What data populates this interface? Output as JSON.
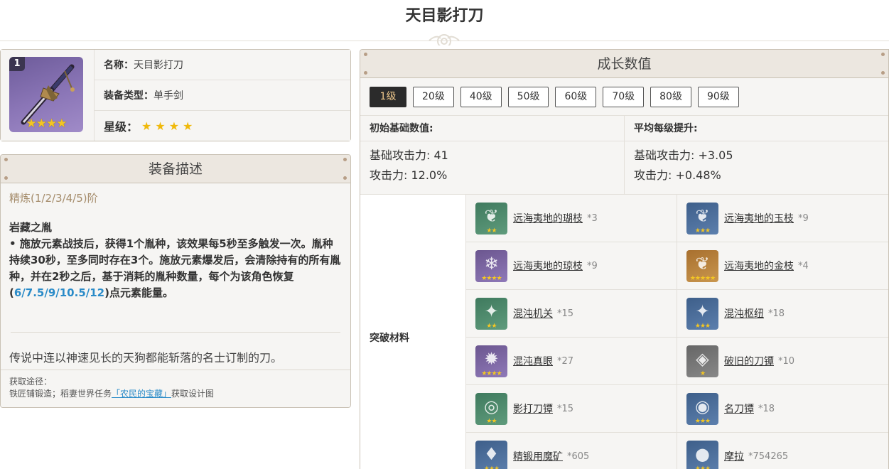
{
  "page_title": "天目影打刀",
  "info": {
    "level_badge": "1",
    "name_label": "名称：",
    "name_value": "天目影打刀",
    "type_label": "装备类型：",
    "type_value": "单手剑",
    "rarity_label": "星级：",
    "rarity_stars": 4,
    "icon_stars": "★★★★"
  },
  "description": {
    "header": "装备描述",
    "refine_label": "精炼(1/2/3/4/5)阶",
    "skill_name": "岩藏之胤",
    "skill_text_1": "• 施放元素战技后，获得1个胤种，该效果每5秒至多触发一次。胤种持续30秒，至多同时存在3个。施放元素爆发后，会清除持有的所有胤种，并在2秒之后，基于消耗的胤种数量，每个为该角色恢复(",
    "skill_values": "6/7.5/9/10.5/12",
    "skill_text_2": ")点元素能量。",
    "lore": "传说中连以神速见长的天狗都能斩落的名士订制的刀。",
    "source_title": "获取途径：",
    "source_prefix": "铁匠铺锻造；稻妻世界任务",
    "source_link": "「农民的宝藏」",
    "source_suffix": "获取设计图"
  },
  "growth": {
    "header": "成长数值",
    "tabs": [
      "1级",
      "20级",
      "40级",
      "50级",
      "60级",
      "70级",
      "80级",
      "90级"
    ],
    "active_tab": 0,
    "base_header": "初始基础数值:",
    "base_lines": [
      "基础攻击力: 41",
      "攻击力: 12.0%"
    ],
    "increase_header": "平均每级提升:",
    "increase_lines": [
      "基础攻击力: +3.05",
      "攻击力: +0.48%"
    ],
    "materials_label": "突破材料",
    "materials": [
      {
        "name": "远海夷地的瑚枝",
        "count": "*3",
        "rarity": 2,
        "icon": "coral-branch-icon",
        "glyph": "❦"
      },
      {
        "name": "远海夷地的玉枝",
        "count": "*9",
        "rarity": 3,
        "icon": "jade-branch-icon",
        "glyph": "❦"
      },
      {
        "name": "远海夷地的琼枝",
        "count": "*9",
        "rarity": 4,
        "icon": "jeweled-branch-icon",
        "glyph": "❄"
      },
      {
        "name": "远海夷地的金枝",
        "count": "*4",
        "rarity": 5,
        "icon": "golden-branch-icon",
        "glyph": "❦"
      },
      {
        "name": "混沌机关",
        "count": "*15",
        "rarity": 2,
        "icon": "chaos-device-icon",
        "glyph": "✦"
      },
      {
        "name": "混沌枢纽",
        "count": "*18",
        "rarity": 3,
        "icon": "chaos-circuit-icon",
        "glyph": "✦"
      },
      {
        "name": "混沌真眼",
        "count": "*27",
        "rarity": 4,
        "icon": "chaos-core-icon",
        "glyph": "✹"
      },
      {
        "name": "破旧的刀镡",
        "count": "*10",
        "rarity": 1,
        "icon": "old-handguard-icon",
        "glyph": "◈"
      },
      {
        "name": "影打刀镡",
        "count": "*15",
        "rarity": 2,
        "icon": "kageuchi-handguard-icon",
        "glyph": "◎"
      },
      {
        "name": "名刀镡",
        "count": "*18",
        "rarity": 3,
        "icon": "famous-handguard-icon",
        "glyph": "◉"
      },
      {
        "name": "精锻用魔矿",
        "count": "*605",
        "rarity": 3,
        "icon": "mystic-ore-icon",
        "glyph": "♦"
      },
      {
        "name": "摩拉",
        "count": "*754265",
        "rarity": 3,
        "icon": "mora-icon",
        "glyph": "●"
      }
    ]
  }
}
